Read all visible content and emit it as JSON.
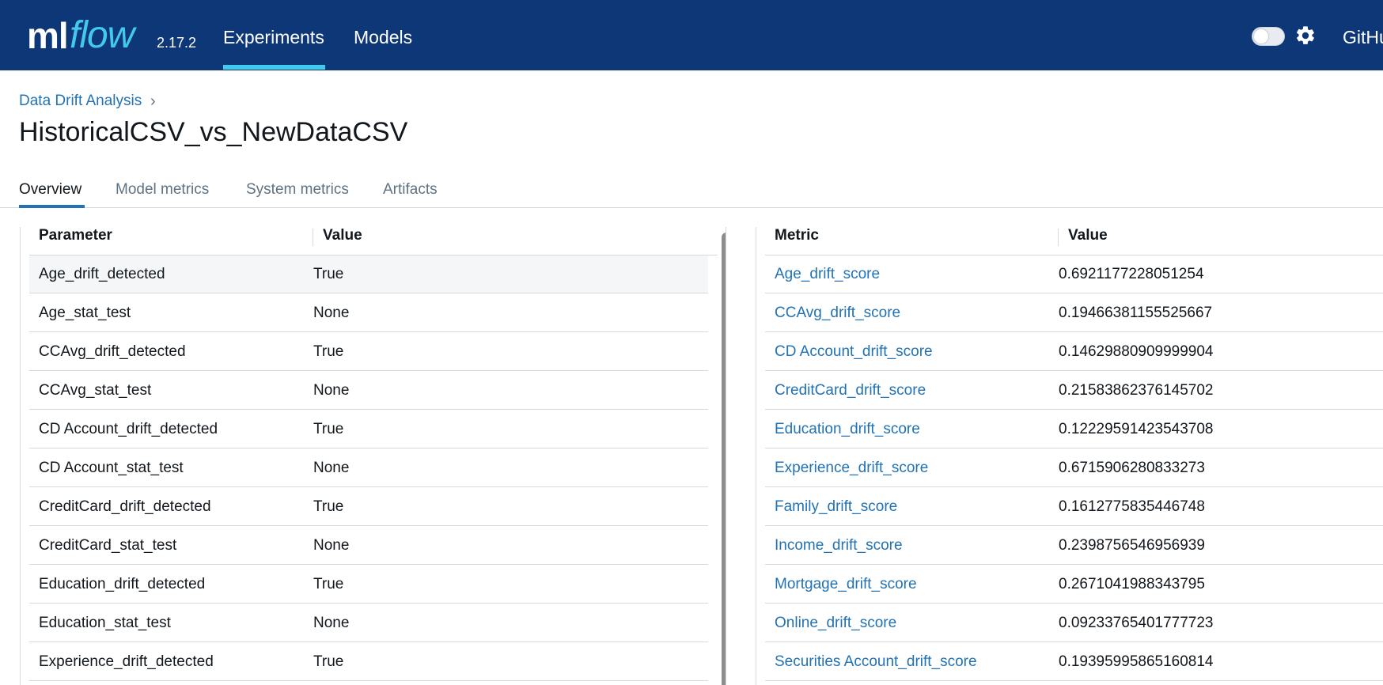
{
  "header": {
    "logo_ml": "ml",
    "logo_flow": "flow",
    "version": "2.17.2",
    "nav": {
      "experiments": "Experiments",
      "models": "Models"
    },
    "github": "GitHu",
    "accent_color": "#43c9ed",
    "background_color": "#0e3777",
    "theme_toggle_icon": "toggle-switch",
    "settings_icon": "gear-icon"
  },
  "page": {
    "breadcrumb": "Data Drift Analysis",
    "breadcrumb_chevron": "›",
    "title": "HistoricalCSV_vs_NewDataCSV"
  },
  "tabs": {
    "overview": "Overview",
    "model_metrics": "Model metrics",
    "system_metrics": "System metrics",
    "artifacts": "Artifacts"
  },
  "params_table": {
    "col_param": "Parameter",
    "col_value": "Value",
    "rows": [
      {
        "name": "Age_drift_detected",
        "value": "True"
      },
      {
        "name": "Age_stat_test",
        "value": "None"
      },
      {
        "name": "CCAvg_drift_detected",
        "value": "True"
      },
      {
        "name": "CCAvg_stat_test",
        "value": "None"
      },
      {
        "name": "CD Account_drift_detected",
        "value": "True"
      },
      {
        "name": "CD Account_stat_test",
        "value": "None"
      },
      {
        "name": "CreditCard_drift_detected",
        "value": "True"
      },
      {
        "name": "CreditCard_stat_test",
        "value": "None"
      },
      {
        "name": "Education_drift_detected",
        "value": "True"
      },
      {
        "name": "Education_stat_test",
        "value": "None"
      },
      {
        "name": "Experience_drift_detected",
        "value": "True"
      }
    ]
  },
  "metrics_table": {
    "col_metric": "Metric",
    "col_value": "Value",
    "rows": [
      {
        "name": "Age_drift_score",
        "value": "0.6921177228051254"
      },
      {
        "name": "CCAvg_drift_score",
        "value": "0.19466381155525667"
      },
      {
        "name": "CD Account_drift_score",
        "value": "0.14629880909999904"
      },
      {
        "name": "CreditCard_drift_score",
        "value": "0.21583862376145702"
      },
      {
        "name": "Education_drift_score",
        "value": "0.12229591423543708"
      },
      {
        "name": "Experience_drift_score",
        "value": "0.6715906280833273"
      },
      {
        "name": "Family_drift_score",
        "value": "0.1612775835446748"
      },
      {
        "name": "Income_drift_score",
        "value": "0.2398756546956939"
      },
      {
        "name": "Mortgage_drift_score",
        "value": "0.2671041988343795"
      },
      {
        "name": "Online_drift_score",
        "value": "0.09233765401777723"
      },
      {
        "name": "Securities Account_drift_score",
        "value": "0.19395995865160814"
      }
    ]
  }
}
